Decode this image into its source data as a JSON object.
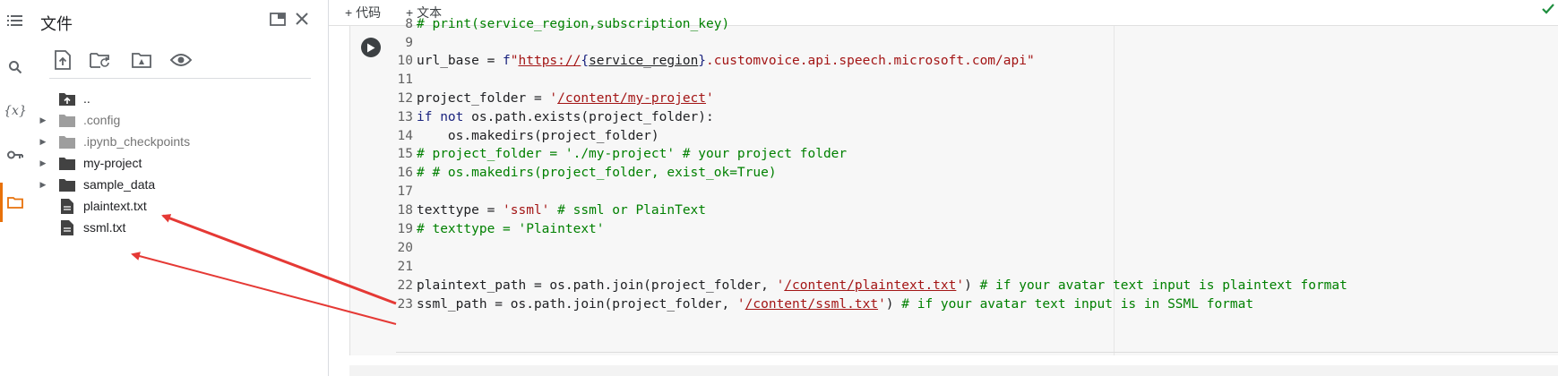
{
  "rail": {
    "icons": [
      "menu-icon",
      "search-icon",
      "variables-icon",
      "key-icon",
      "folder-icon"
    ],
    "variables_glyph": "{x}"
  },
  "panel": {
    "title": "文件",
    "files": [
      {
        "label": "..",
        "type": "up-folder",
        "muted": false,
        "caret": false
      },
      {
        "label": ".config",
        "type": "folder",
        "muted": true,
        "caret": true
      },
      {
        "label": ".ipynb_checkpoints",
        "type": "folder",
        "muted": true,
        "caret": true
      },
      {
        "label": "my-project",
        "type": "folder",
        "muted": false,
        "caret": true
      },
      {
        "label": "sample_data",
        "type": "folder",
        "muted": false,
        "caret": true
      },
      {
        "label": "plaintext.txt",
        "type": "file",
        "muted": false,
        "caret": false
      },
      {
        "label": "ssml.txt",
        "type": "file",
        "muted": false,
        "caret": false
      }
    ]
  },
  "notebook": {
    "add_code": "+ 代码",
    "add_text": "+ 文本",
    "code_lines": [
      {
        "n": "8",
        "text": "# print(service_region,subscription_key)"
      },
      {
        "n": "9",
        "text": ""
      },
      {
        "n": "10",
        "text": "url_base = f\"https://{service_region}.customvoice.api.speech.microsoft.com/api\""
      },
      {
        "n": "11",
        "text": ""
      },
      {
        "n": "12",
        "text": "project_folder = '/content/my-project'"
      },
      {
        "n": "13",
        "text": "if not os.path.exists(project_folder):"
      },
      {
        "n": "14",
        "text": "    os.makedirs(project_folder)"
      },
      {
        "n": "15",
        "text": "# project_folder = './my-project' # your project folder"
      },
      {
        "n": "16",
        "text": "# # os.makedirs(project_folder, exist_ok=True)"
      },
      {
        "n": "17",
        "text": ""
      },
      {
        "n": "18",
        "text": "texttype = 'ssml' # ssml or PlainText"
      },
      {
        "n": "19",
        "text": "# texttype = 'Plaintext'"
      },
      {
        "n": "20",
        "text": ""
      },
      {
        "n": "21",
        "text": ""
      },
      {
        "n": "22",
        "text": "plaintext_path = os.path.join(project_folder, '/content/plaintext.txt') # if your avatar text input is plaintext format"
      },
      {
        "n": "23",
        "text": "ssml_path = os.path.join(project_folder, '/content/ssml.txt') # if your avatar text input is in SSML format"
      }
    ]
  },
  "colors": {
    "accent": "#e8710a",
    "arrow": "#e53935",
    "keyword": "#1a237e",
    "string": "#a31515",
    "comment": "#008000"
  }
}
